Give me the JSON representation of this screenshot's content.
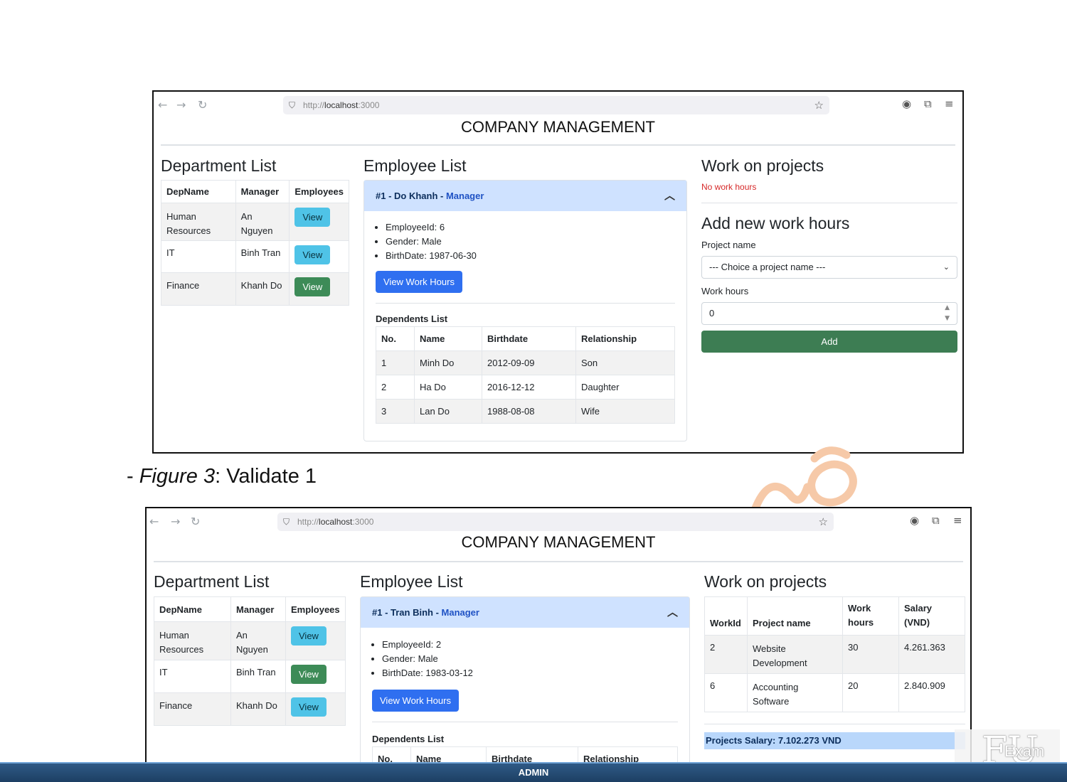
{
  "browser": {
    "url_prefix": "http://",
    "url_host": "localhost",
    "url_port": ":3000"
  },
  "app_title": "COMPANY MANAGEMENT",
  "figure1": {
    "department_list": {
      "title": "Department List",
      "headers": [
        "DepName",
        "Manager",
        "Employees"
      ],
      "rows": [
        {
          "name_line1": "Human",
          "name_line2": "Resources",
          "mgr_line1": "An",
          "mgr_line2": "Nguyen",
          "button": "View",
          "style": "info"
        },
        {
          "name_line1": "IT",
          "name_line2": "",
          "mgr_line1": "Binh Tran",
          "mgr_line2": "",
          "button": "View",
          "style": "info"
        },
        {
          "name_line1": "Finance",
          "name_line2": "",
          "mgr_line1": "Khanh Do",
          "mgr_line2": "",
          "button": "View",
          "style": "success"
        }
      ]
    },
    "employee_list": {
      "title": "Employee List",
      "accordion_header": "#1 - Do Khanh - ",
      "accordion_role": "Manager",
      "info": [
        "EmployeeId: 6",
        "Gender: Male",
        "BirthDate: 1987-06-30"
      ],
      "view_button": "View Work Hours",
      "dependents_label": "Dependents List",
      "dep_headers": [
        "No.",
        "Name",
        "Birthdate",
        "Relationship"
      ],
      "dep_rows": [
        [
          "1",
          "Minh Do",
          "2012-09-09",
          "Son"
        ],
        [
          "2",
          "Ha Do",
          "2016-12-12",
          "Daughter"
        ],
        [
          "3",
          "Lan Do",
          "1988-08-08",
          "Wife"
        ]
      ]
    },
    "work_on_projects": {
      "title": "Work on projects",
      "empty_message": "No work hours",
      "add_title": "Add new work hours",
      "project_label": "Project name",
      "project_placeholder": "--- Choice a project name ---",
      "hours_label": "Work hours",
      "hours_value": "0",
      "add_button": "Add"
    }
  },
  "caption": {
    "prefix": "- ",
    "figure": "Figure 3",
    "suffix": ": Validate 1"
  },
  "figure2": {
    "department_list": {
      "title": "Department List",
      "headers": [
        "DepName",
        "Manager",
        "Employees"
      ],
      "rows": [
        {
          "name_line1": "Human",
          "name_line2": "Resources",
          "mgr_line1": "An",
          "mgr_line2": "Nguyen",
          "button": "View",
          "style": "info"
        },
        {
          "name_line1": "IT",
          "name_line2": "",
          "mgr_line1": "Binh Tran",
          "mgr_line2": "",
          "button": "View",
          "style": "success"
        },
        {
          "name_line1": "Finance",
          "name_line2": "",
          "mgr_line1": "Khanh Do",
          "mgr_line2": "",
          "button": "View",
          "style": "info"
        }
      ]
    },
    "employee_list": {
      "title": "Employee List",
      "accordion_header": "#1 - Tran Binh - ",
      "accordion_role": "Manager",
      "info": [
        "EmployeeId: 2",
        "Gender: Male",
        "BirthDate: 1983-03-12"
      ],
      "view_button": "View Work Hours",
      "dependents_label": "Dependents List",
      "dep_headers": [
        "No.",
        "Name",
        "Birthdate",
        "Relationship"
      ]
    },
    "work_on_projects": {
      "title": "Work on projects",
      "headers": [
        {
          "line1": "",
          "line2": "WorkId"
        },
        {
          "line1": "",
          "line2": "Project name"
        },
        {
          "line1": "Work",
          "line2": "hours"
        },
        {
          "line1": "Salary",
          "line2": "(VND)"
        }
      ],
      "rows": [
        {
          "id": "2",
          "name_line1": "Website",
          "name_line2": "Development",
          "hours": "30",
          "salary": "4.261.363"
        },
        {
          "id": "6",
          "name_line1": "Accounting",
          "name_line2": "Software",
          "hours": "20",
          "salary": "2.840.909"
        }
      ],
      "salary_total": "Projects Salary: 7.102.273 VND"
    }
  },
  "logo": {
    "text1": "FU",
    "text2": "Exam"
  },
  "footer": {
    "label": "ADMIN"
  }
}
